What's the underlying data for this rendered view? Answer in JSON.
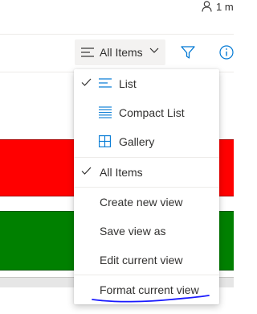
{
  "header": {
    "user_text": "1 m"
  },
  "command_bar": {
    "view_selector_label": "All Items"
  },
  "view_menu": {
    "layout_items": [
      {
        "label": "List",
        "checked": true,
        "icon": "list-icon"
      },
      {
        "label": "Compact List",
        "checked": false,
        "icon": "compact-list-icon"
      },
      {
        "label": "Gallery",
        "checked": false,
        "icon": "gallery-icon"
      }
    ],
    "views": [
      {
        "label": "All Items",
        "checked": true
      }
    ],
    "actions": [
      {
        "label": "Create new view"
      },
      {
        "label": "Save view as"
      },
      {
        "label": "Edit current view"
      },
      {
        "label": "Format current view"
      }
    ]
  },
  "colors": {
    "row_red": "#ff0000",
    "row_green": "#008000",
    "accent": "#0078d4",
    "annotation": "#1a1aff"
  }
}
